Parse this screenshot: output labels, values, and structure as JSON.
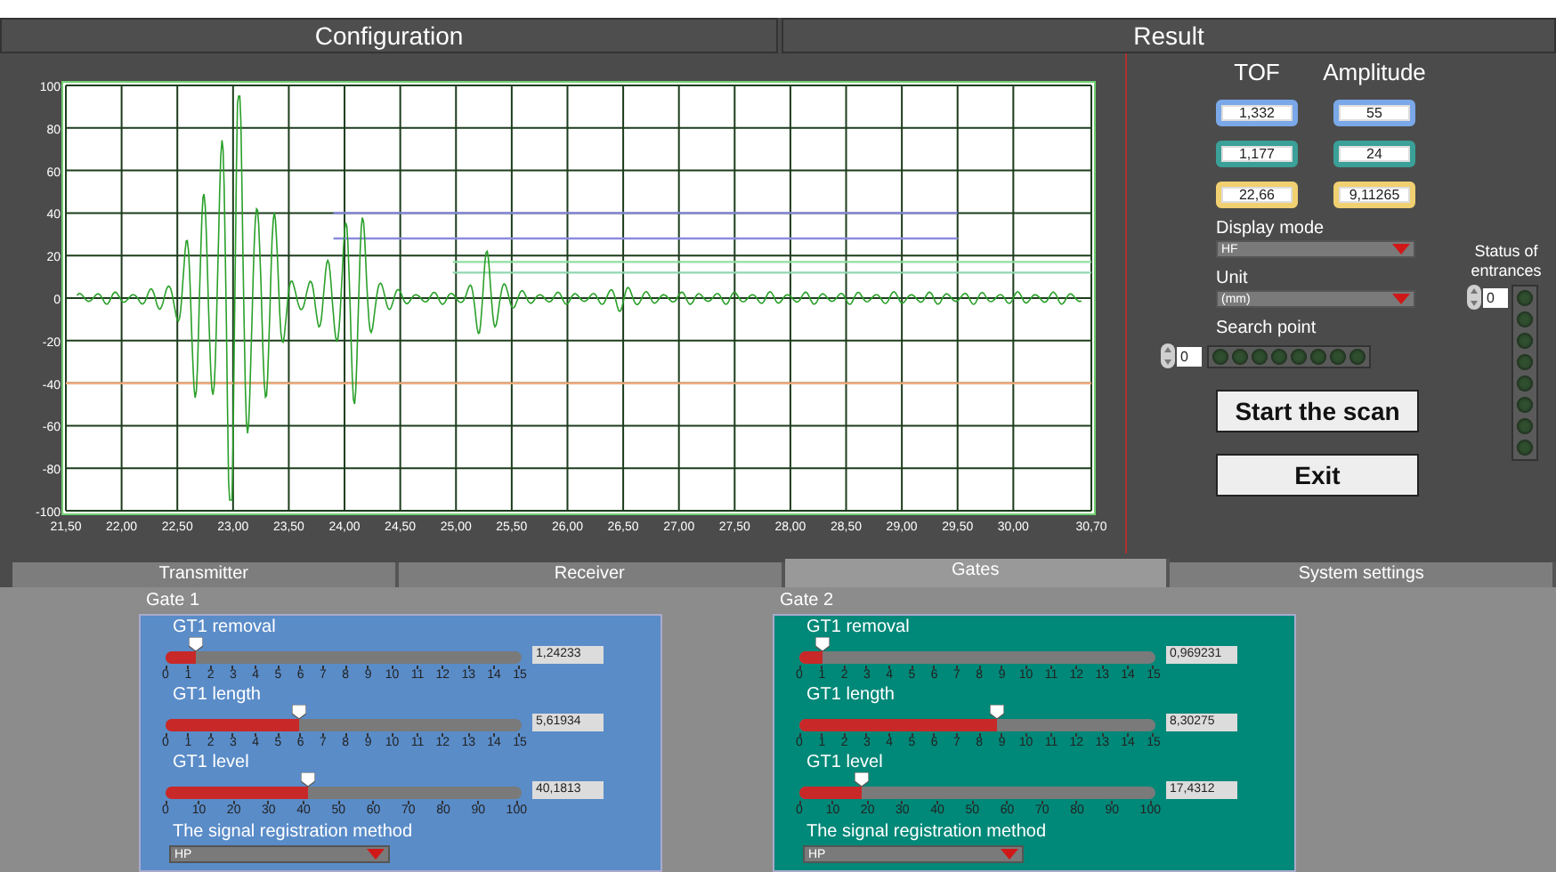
{
  "header": {
    "left": "Configuration",
    "right": "Result"
  },
  "chart": {
    "chart_data": {
      "type": "line",
      "grid": true,
      "x": [
        21.5,
        23.9,
        24.97,
        29.5,
        30.7
      ],
      "xlim": [
        21.5,
        30.7
      ],
      "ylim": [
        -100,
        100
      ],
      "xticks": [
        {
          "value": 21.5,
          "label": "21,50"
        },
        {
          "value": 22,
          "label": "22,00"
        },
        {
          "value": 22.5,
          "label": "22,50"
        },
        {
          "value": 23,
          "label": "23,00"
        },
        {
          "value": 23.5,
          "label": "23,50"
        },
        {
          "value": 24,
          "label": "24,00"
        },
        {
          "value": 24.5,
          "label": "24,50"
        },
        {
          "value": 25,
          "label": "25,00"
        },
        {
          "value": 25.5,
          "label": "25,50"
        },
        {
          "value": 26,
          "label": "26,00"
        },
        {
          "value": 26.5,
          "label": "26,50"
        },
        {
          "value": 27,
          "label": "27,00"
        },
        {
          "value": 27.5,
          "label": "27,50"
        },
        {
          "value": 28,
          "label": "28,00"
        },
        {
          "value": 28.5,
          "label": "28,50"
        },
        {
          "value": 29,
          "label": "29,00"
        },
        {
          "value": 29.5,
          "label": "29,50"
        },
        {
          "value": 30,
          "label": "30,00"
        },
        {
          "value": 30.7,
          "label": "30,70"
        }
      ],
      "yticks": [
        100,
        80,
        60,
        40,
        20,
        0,
        -20,
        -40,
        -60,
        -80,
        -100
      ],
      "series": [
        {
          "color": "#8c8ce0",
          "values": [
            null,
            40,
            40,
            40,
            null
          ]
        },
        {
          "color": "#8c8ce0",
          "values": [
            null,
            28,
            28,
            28,
            null
          ]
        },
        {
          "color": "#90e0a0",
          "values": [
            null,
            null,
            17,
            17,
            17
          ]
        },
        {
          "color": "#90d8b0",
          "values": [
            null,
            null,
            12,
            12,
            12
          ]
        },
        {
          "color": "#ffb080",
          "values": [
            -40,
            -40,
            -40,
            -40,
            -40
          ]
        }
      ]
    }
  },
  "readouts": {
    "columns": [
      "TOF",
      "Amplitude"
    ],
    "rows": [
      {
        "color": "#7aa8e8",
        "tof": "1,332",
        "amplitude": "55"
      },
      {
        "color": "#3aa098",
        "tof": "1,177",
        "amplitude": "24"
      },
      {
        "color": "#f0d070",
        "tof": "22,66",
        "amplitude": "9,11265"
      }
    ]
  },
  "display_mode": {
    "label": "Display mode",
    "value": "HF"
  },
  "unit": {
    "label": "Unit",
    "value": "(mm)"
  },
  "search_point": {
    "label": "Search point",
    "index": "0",
    "leds": [
      {
        "on": false
      },
      {
        "on": false
      },
      {
        "on": false
      },
      {
        "on": false
      },
      {
        "on": false
      },
      {
        "on": false
      },
      {
        "on": false
      },
      {
        "on": false
      }
    ]
  },
  "buttons": [
    "Start the scan",
    "Exit"
  ],
  "status": {
    "label": "Status of entrances",
    "index": "0",
    "leds": [
      {
        "on": false
      },
      {
        "on": false
      },
      {
        "on": false
      },
      {
        "on": false
      },
      {
        "on": false
      },
      {
        "on": false
      },
      {
        "on": false
      },
      {
        "on": false
      }
    ]
  },
  "tabs": [
    {
      "label": "Transmitter",
      "selected": false
    },
    {
      "label": "Receiver",
      "selected": false
    },
    {
      "label": "Gates",
      "selected": true
    },
    {
      "label": "System settings",
      "selected": false
    }
  ],
  "gates": [
    {
      "title": "Gate 1",
      "color": "#5a8cc8",
      "sliders": [
        {
          "label": "GT1 removal",
          "level": 0.0828,
          "reading": "1,24233",
          "scale": [
            "0",
            "1",
            "2",
            "3",
            "4",
            "5",
            "6",
            "7",
            "8",
            "9",
            "10",
            "11",
            "12",
            "13",
            "14",
            "15"
          ]
        },
        {
          "label": "GT1 length",
          "level": 0.3746,
          "reading": "5,61934",
          "scale": [
            "0",
            "1",
            "2",
            "3",
            "4",
            "5",
            "6",
            "7",
            "8",
            "9",
            "10",
            "11",
            "12",
            "13",
            "14",
            "15"
          ]
        },
        {
          "label": "GT1 level",
          "level": 0.4018,
          "reading": "40,1813",
          "scale": [
            "0",
            "10",
            "20",
            "30",
            "40",
            "50",
            "60",
            "70",
            "80",
            "90",
            "100"
          ]
        }
      ],
      "method": {
        "label": "The signal registration method",
        "value": "HP"
      }
    },
    {
      "title": "Gate 2",
      "color": "#008878",
      "sliders": [
        {
          "label": "GT1 removal",
          "level": 0.0646,
          "reading": "0,969231",
          "scale": [
            "0",
            "1",
            "2",
            "3",
            "4",
            "5",
            "6",
            "7",
            "8",
            "9",
            "10",
            "11",
            "12",
            "13",
            "14",
            "15"
          ]
        },
        {
          "label": "GT1 length",
          "level": 0.5535,
          "reading": "8,30275",
          "scale": [
            "0",
            "1",
            "2",
            "3",
            "4",
            "5",
            "6",
            "7",
            "8",
            "9",
            "10",
            "11",
            "12",
            "13",
            "14",
            "15"
          ]
        },
        {
          "label": "GT1 level",
          "level": 0.1743,
          "reading": "17,4312",
          "scale": [
            "0",
            "10",
            "20",
            "30",
            "40",
            "50",
            "60",
            "70",
            "80",
            "90",
            "100"
          ]
        }
      ],
      "method": {
        "label": "The signal registration method",
        "value": "HP"
      }
    }
  ]
}
